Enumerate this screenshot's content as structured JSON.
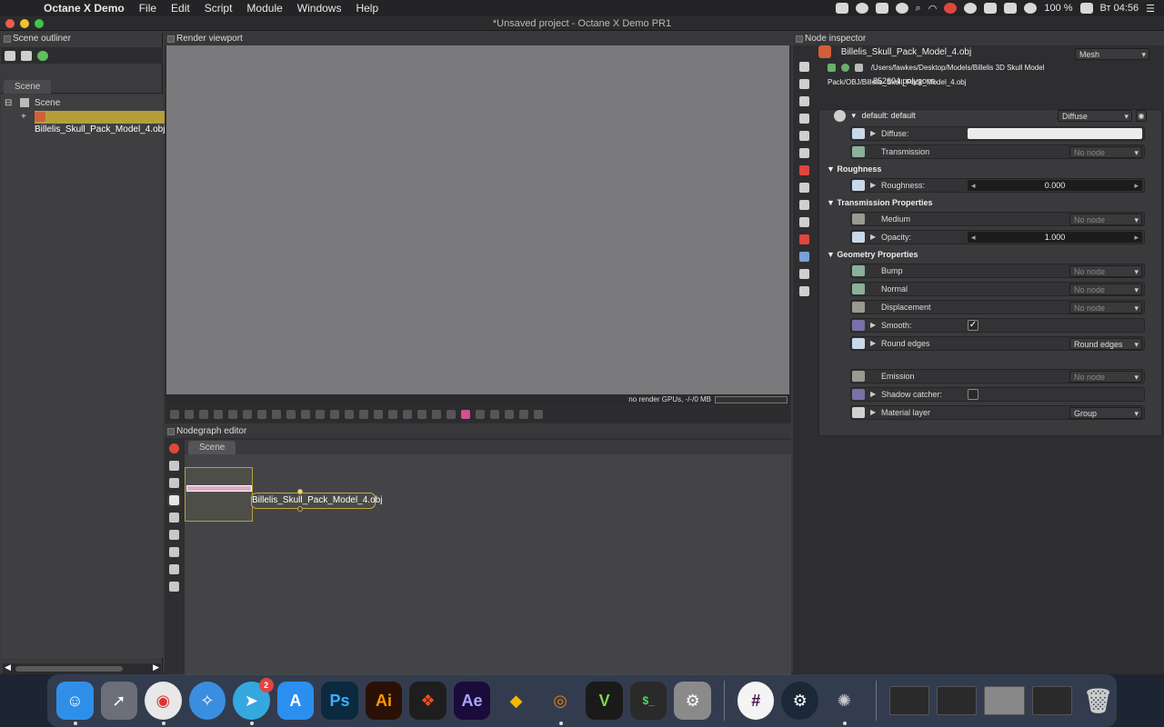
{
  "menubar": {
    "app_name": "Octane X Demo",
    "items": [
      "File",
      "Edit",
      "Script",
      "Module",
      "Windows",
      "Help"
    ],
    "battery": "100 %",
    "clock": "Вт 04:56"
  },
  "window": {
    "title": "*Unsaved project - Octane X Demo PR1"
  },
  "outliner": {
    "title": "Scene outliner",
    "tab": "Scene",
    "root": "Scene",
    "child": "Billelis_Skull_Pack_Model_4.obj"
  },
  "viewport": {
    "title": "Render viewport",
    "status": "no render GPUs, -/-/0 MB"
  },
  "nodegraph": {
    "title": "Nodegraph editor",
    "tab": "Scene",
    "node_label": "Billelis_Skull_Pack_Model_4.obj"
  },
  "inspector": {
    "title": "Node inspector",
    "node_name": "Billelis_Skull_Pack_Model_4.obj",
    "node_type": "Mesh",
    "path": "/Users/fawkes/Desktop/Models/Billelis 3D Skull Model Pack/OBJ/Billelis_Skull_Pack_Model_4.obj",
    "polygons": "852604 polygons",
    "material_label": "default: default",
    "material_type": "Diffuse",
    "rows": {
      "diffuse": "Diffuse:",
      "transmission": "Transmission",
      "transmission_value": "No node",
      "roughness_section": "Roughness",
      "roughness": "Roughness:",
      "roughness_value": "0.000",
      "trans_props_section": "Transmission Properties",
      "medium": "Medium",
      "medium_value": "No node",
      "opacity": "Opacity:",
      "opacity_value": "1.000",
      "geometry_section": "Geometry Properties",
      "bump": "Bump",
      "bump_value": "No node",
      "normal": "Normal",
      "normal_value": "No node",
      "displacement": "Displacement",
      "displacement_value": "No node",
      "smooth": "Smooth:",
      "round_edges": "Round edges",
      "round_edges_value": "Round edges",
      "emission": "Emission",
      "emission_value": "No node",
      "shadow_catcher": "Shadow catcher:",
      "material_layer": "Material layer",
      "material_layer_value": "Group"
    }
  },
  "dock": {
    "telegram_badge": "2",
    "apps": [
      "Finder",
      "Launchpad",
      "Chrome",
      "Safari",
      "Telegram",
      "App Store",
      "Ps",
      "Ai",
      "Figma",
      "Ae",
      "Sketch",
      "Blender",
      "Vectorworks",
      "Terminal",
      "System Preferences",
      "Slack",
      "Steam",
      "Octane"
    ]
  },
  "colors": {
    "selection": "#b59e3a",
    "viewport_bg": "#7a7a7c",
    "panel_bg": "#3a3a3c"
  }
}
